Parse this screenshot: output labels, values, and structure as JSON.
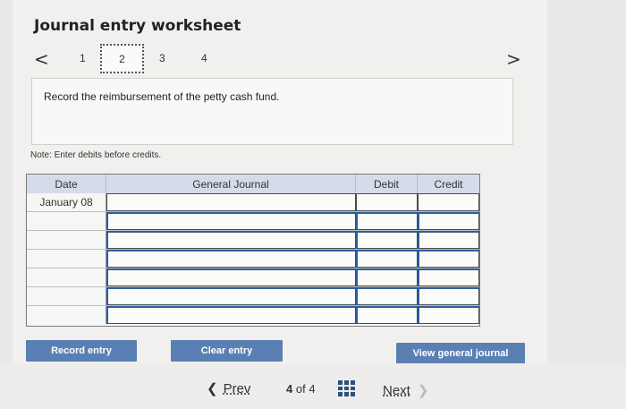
{
  "title": "Journal entry worksheet",
  "nav": {
    "prev": "<",
    "next": ">"
  },
  "steps": [
    "1",
    "2",
    "3",
    "4"
  ],
  "instruction": "Record the reimbursement of the petty cash fund.",
  "note": "Note: Enter debits before credits.",
  "journal": {
    "headers": {
      "date": "Date",
      "general_journal": "General Journal",
      "debit": "Debit",
      "credit": "Credit"
    },
    "rows": [
      {
        "date": "January 08"
      },
      {
        "date": ""
      },
      {
        "date": ""
      },
      {
        "date": ""
      },
      {
        "date": ""
      },
      {
        "date": ""
      },
      {
        "date": ""
      }
    ]
  },
  "buttons": {
    "record": "Record entry",
    "clear": "Clear entry",
    "view": "View general journal"
  },
  "pager": {
    "prev": "Prev",
    "current": "4",
    "of": "of",
    "total": "4",
    "next": "Next"
  }
}
